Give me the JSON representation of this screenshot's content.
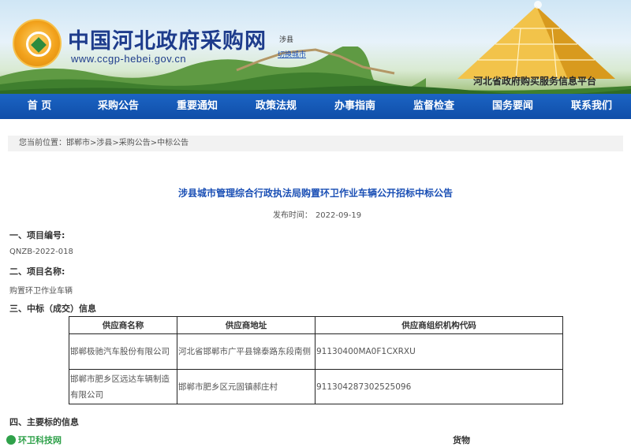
{
  "header": {
    "site_title": "中国河北政府采购网",
    "site_url": "www.ccgp-hebei.gov.cn",
    "region": "涉县",
    "switch_city": "切换城市",
    "platform_name": "河北省政府购买服务信息平台"
  },
  "nav": {
    "items": [
      "首 页",
      "采购公告",
      "重要通知",
      "政策法规",
      "办事指南",
      "监督检查",
      "国务要闻",
      "联系我们"
    ]
  },
  "breadcrumb": {
    "prefix": "您当前位置：",
    "items": [
      "邯郸市",
      "涉县",
      "采购公告",
      "中标公告"
    ],
    "separator": ">"
  },
  "article": {
    "title": "涉县城市管理综合行政执法局购置环卫作业车辆公开招标中标公告",
    "date_label": "发布时间：",
    "date": "2022-09-19",
    "section1": "一、项目编号:",
    "project_number": "QNZB-2022-018",
    "section2": "二、项目名称:",
    "project_name": "购置环卫作业车辆",
    "section3": "三、中标（成交）信息",
    "table": {
      "headers": [
        "供应商名称",
        "供应商地址",
        "供应商组织机构代码"
      ],
      "rows": [
        [
          "邯郸极驰汽车股份有限公司",
          "河北省邯郸市广平县锦泰路东段南侧",
          "91130400MA0F1CXRXU"
        ],
        [
          "邯郸市肥乡区远达车辆制造有限公司",
          "邯郸市肥乡区元固镇郝庄村",
          "911304287302525096"
        ]
      ]
    },
    "section4": "四、主要标的信息",
    "goods_label": "货物"
  },
  "watermark": "环卫科技网"
}
